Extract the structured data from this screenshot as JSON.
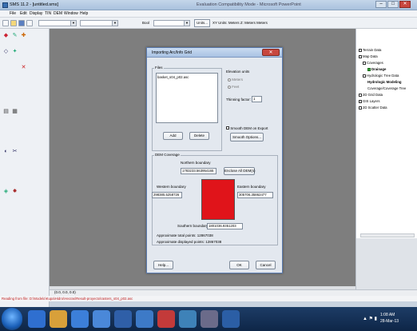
{
  "window": {
    "title": "SMS 11.2 - [untitled.sms]",
    "center_title": "Evaluation Compatibility Mode - Microsoft PowerPoint",
    "minimize": "–",
    "maximize": "□",
    "close": "✕"
  },
  "menu": [
    "File",
    "Edit",
    "Display",
    "TIN",
    "DEM",
    "Window",
    "Help"
  ],
  "toolbar": {
    "field_label": "Bool",
    "units_button": "Units...",
    "units_text": "XY Units: Meters   Z: Meters   Meters"
  },
  "palette_tools": [
    "◆",
    "✎",
    "✚",
    "◇",
    "✦",
    "✕",
    "▤",
    "▦",
    "◐",
    "✂",
    "◈",
    "✸"
  ],
  "tree": {
    "items": [
      "Terrain Data",
      "Map Data",
      "Coverages",
      "Drainage",
      "Hydrologic Tree Data",
      "Hydrologic Modeling",
      "Coverage/Coverage Tree",
      "2D Grid Data",
      "GIS Layers",
      "2D Scatter Data"
    ]
  },
  "status": {
    "coords": "(0.0, 0.0, 0.0)",
    "message": "Reading from file: D:\\Modelo\\Kupa\\Hidro\\Hecras\\Result-proyecto\\rasters_s04_p02.asc"
  },
  "dialog": {
    "title": "Importing Arc/Info Grid",
    "files_label": "Files",
    "file_entry": "basket_s04_p02.asc",
    "elevation_units_label": "Elevation units",
    "unit_meters": "Meters",
    "unit_feet": "Feet",
    "thinning_label": "Thinning factor:",
    "thinning_value": "1",
    "smooth_label": "Smooth DEM on Export",
    "smooth_options": "Smooth Options...",
    "add": "Add",
    "delete": "Delete",
    "coverage_label": "DEM Coverage",
    "northern_label": "Northern boundary",
    "northern_value": "1783233.563954165",
    "enclose_button": "Enclose All DEM(s)",
    "western_label": "Western boundary",
    "western_value": "298385.5258726",
    "eastern_label": "Eastern boundary",
    "eastern_value": "305706.35862477",
    "southern_label": "Southern boundary",
    "southern_value": "1801036.9351203",
    "total_points": "Approximate total points: 12867038",
    "display_points": "Approximate displayed points: 12867038",
    "help": "Help...",
    "ok": "OK",
    "cancel": "Cancel",
    "coverage_color": "#e0141a"
  },
  "taskbar": {
    "time": "1:08 AM",
    "date": "28-Mar-13",
    "tray_icons": "▲  ⚑  ▮"
  },
  "colors": {
    "canvas": "#7e7e7e",
    "taskbar": "#1d3c66",
    "status_message": "#c02020"
  }
}
